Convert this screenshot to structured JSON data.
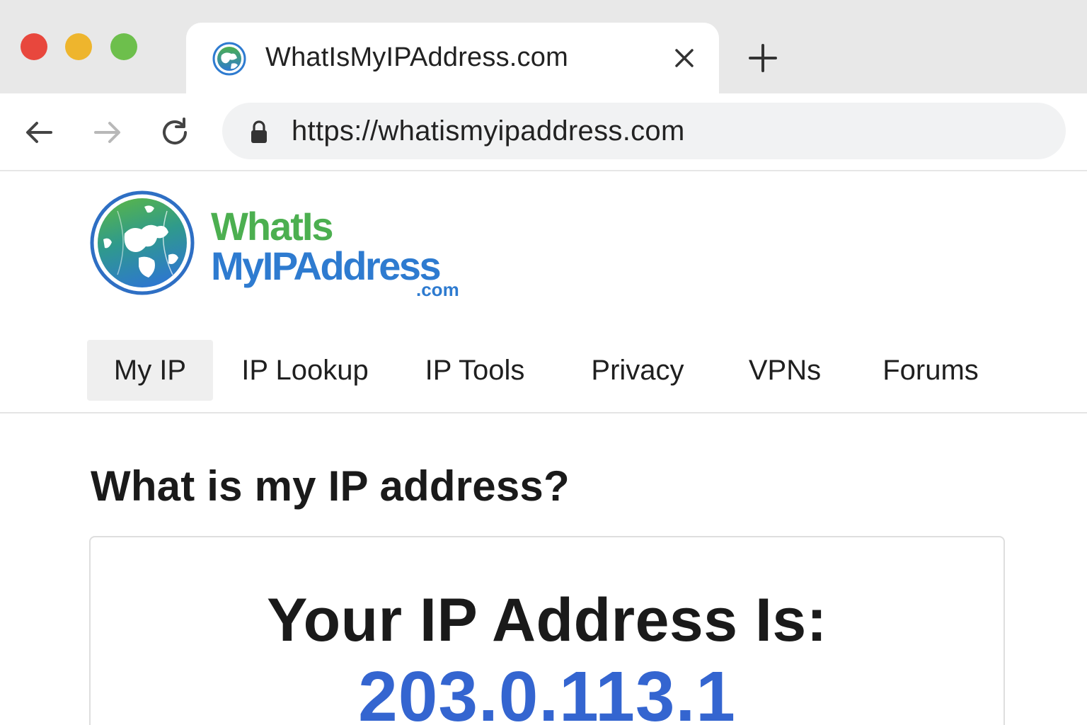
{
  "window": {
    "controls": [
      "close",
      "minimize",
      "maximize"
    ],
    "colors": {
      "close": "#e8473d",
      "minimize": "#eeb52d",
      "maximize": "#6dbf4c"
    }
  },
  "tab": {
    "title": "WhatIsMyIPAddress.com",
    "favicon": "globe-icon",
    "close_icon": "close-icon",
    "new_tab_icon": "plus-icon"
  },
  "toolbar": {
    "back_icon": "arrow-left-icon",
    "forward_icon": "arrow-right-icon",
    "reload_icon": "reload-icon",
    "lock_icon": "lock-icon",
    "url": "https://whatismyipaddress.com"
  },
  "site": {
    "logo": {
      "line1": "WhatIs",
      "line2": "MyIPAddress",
      "suffix": ".com",
      "icon": "globe-icon",
      "colors": {
        "green": "#4caf50",
        "blue": "#2e7bd0"
      }
    },
    "nav": [
      {
        "label": "My IP",
        "active": true
      },
      {
        "label": "IP Lookup",
        "active": false
      },
      {
        "label": "IP Tools",
        "active": false
      },
      {
        "label": "Privacy",
        "active": false
      },
      {
        "label": "VPNs",
        "active": false
      },
      {
        "label": "Forums",
        "active": false
      }
    ]
  },
  "main": {
    "title": "What is my IP address?",
    "card": {
      "heading": "Your IP Address Is:",
      "ip": "203.0.113.1",
      "ip_color": "#3465d0"
    }
  }
}
